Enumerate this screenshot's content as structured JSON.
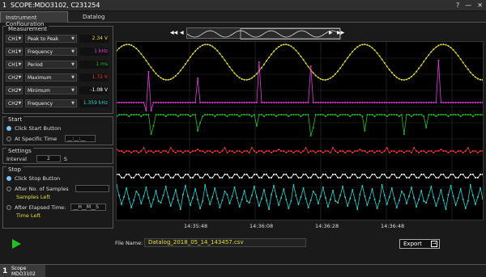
{
  "titlebar": {
    "num": "1",
    "title": "SCOPE:MDO3102, C231254"
  },
  "window_buttons": [
    "?",
    "—",
    "✕"
  ],
  "tabs": [
    "Instrument Configuration",
    "Datalog"
  ],
  "measurement": {
    "title": "Measurement",
    "rows": [
      {
        "ch": "CH1",
        "meas": "Peak to Peak",
        "value": "2.34 V",
        "color": "#e6df2a"
      },
      {
        "ch": "CH1",
        "meas": "Frequency",
        "value": "1 kHz",
        "color": "#e43ee4"
      },
      {
        "ch": "CH1",
        "meas": "Period",
        "value": "1 ms",
        "color": "#22c022"
      },
      {
        "ch": "CH2",
        "meas": "Maximum",
        "value": "1.72 V",
        "color": "#ff3030"
      },
      {
        "ch": "CH2",
        "meas": "Minimum",
        "value": "-1.08 V",
        "color": "#ffffff"
      },
      {
        "ch": "CH2",
        "meas": "Frequency",
        "value": "1.359 kHz",
        "color": "#22d5d5"
      }
    ]
  },
  "start": {
    "title": "Start",
    "opt1": "Click Start Button",
    "opt2": "At Specific Time",
    "time_value": "__:__:__"
  },
  "settings": {
    "title": "Settings",
    "interval_label": "Interval",
    "interval_value": "2",
    "interval_unit": "S"
  },
  "stop": {
    "title": "Stop",
    "opt1": "Click Stop Button",
    "opt2": "After No. of Samples",
    "samples_left": "Samples Left",
    "opt3": "After Elapsed Time:",
    "elapsed_value": "__H__M__S",
    "time_left": "Time Left"
  },
  "scope": {
    "time_labels": [
      "14:35:48",
      "14:36:08",
      "14:36:28",
      "14:36:48"
    ],
    "nav": {
      "first": "◀◀",
      "prev": "◀",
      "next": "▶",
      "last": "▶▶"
    }
  },
  "file": {
    "label": "File Name:",
    "name": "Datalog_2018_05_14_143457.csv"
  },
  "export": {
    "label": "Export"
  },
  "bottom": {
    "num": "1",
    "line1": "Scope",
    "line2": "MDO3102"
  },
  "trace_colors": [
    "#e6df2a",
    "#e43ee4",
    "#22c022",
    "#ff3030",
    "#ffffff",
    "#22d5d5"
  ]
}
